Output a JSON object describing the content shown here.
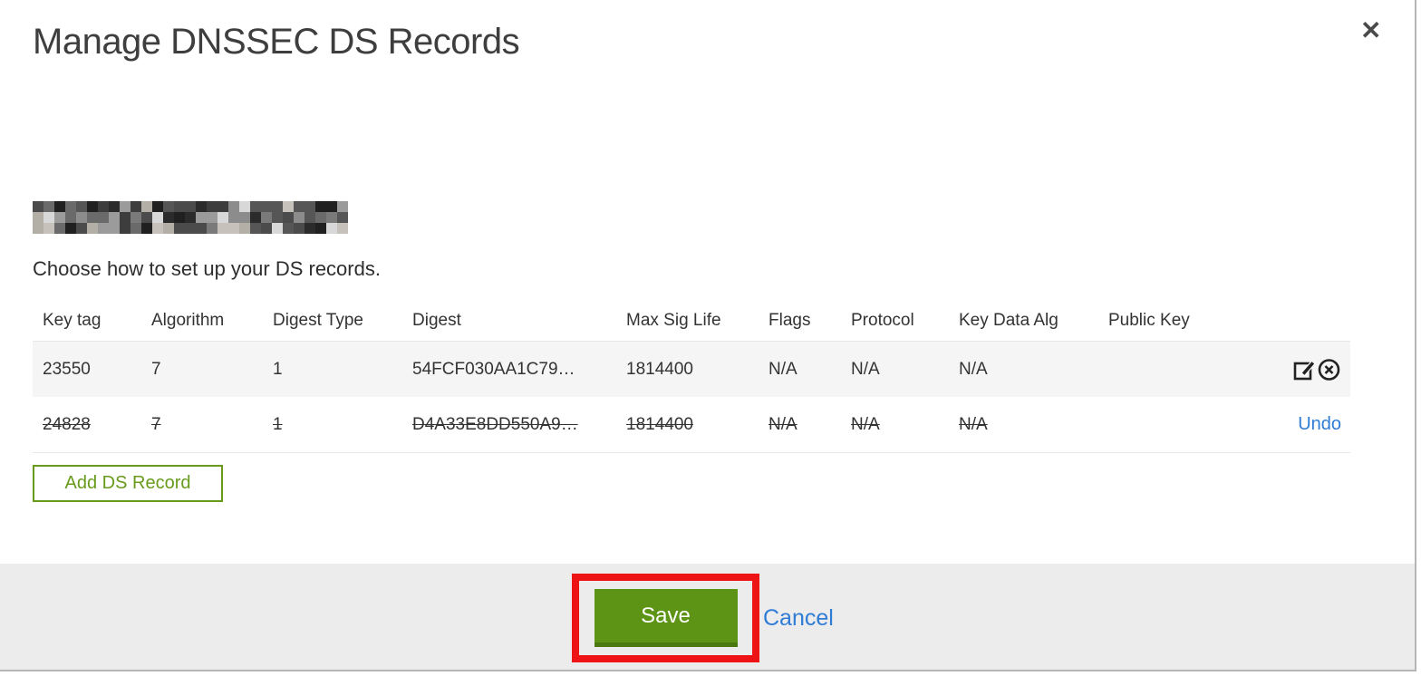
{
  "dialog": {
    "title": "Manage DNSSEC DS Records",
    "subtitle": "Choose how to set up your DS records.",
    "close_glyph": "✕"
  },
  "table": {
    "headers": [
      "Key tag",
      "Algorithm",
      "Digest Type",
      "Digest",
      "Max Sig Life",
      "Flags",
      "Protocol",
      "Key Data Alg",
      "Public Key"
    ],
    "rows": [
      {
        "key_tag": "23550",
        "algorithm": "7",
        "digest_type": "1",
        "digest": "54FCF030AA1C79…",
        "max_sig_life": "1814400",
        "flags": "N/A",
        "protocol": "N/A",
        "key_data_alg": "N/A",
        "public_key": "",
        "status": "active"
      },
      {
        "key_tag": "24828",
        "algorithm": "7",
        "digest_type": "1",
        "digest": "D4A33E8DD550A9…",
        "max_sig_life": "1814400",
        "flags": "N/A",
        "protocol": "N/A",
        "key_data_alg": "N/A",
        "public_key": "",
        "status": "marked-for-deletion",
        "undo_label": "Undo"
      }
    ]
  },
  "buttons": {
    "add_ds_record": "Add DS Record",
    "save": "Save",
    "cancel": "Cancel"
  },
  "icons": {
    "close": "close-x",
    "edit": "edit-pencil-square",
    "delete": "circle-x"
  },
  "colors": {
    "accent_green": "#5d9415",
    "accent_green_dark": "#4b780f",
    "outline_green": "#689b1c",
    "link_blue": "#2e7cd6",
    "annotation_red": "#ee1416",
    "footer_gray": "#ececec",
    "row_stripe_gray": "#f5f5f5"
  }
}
